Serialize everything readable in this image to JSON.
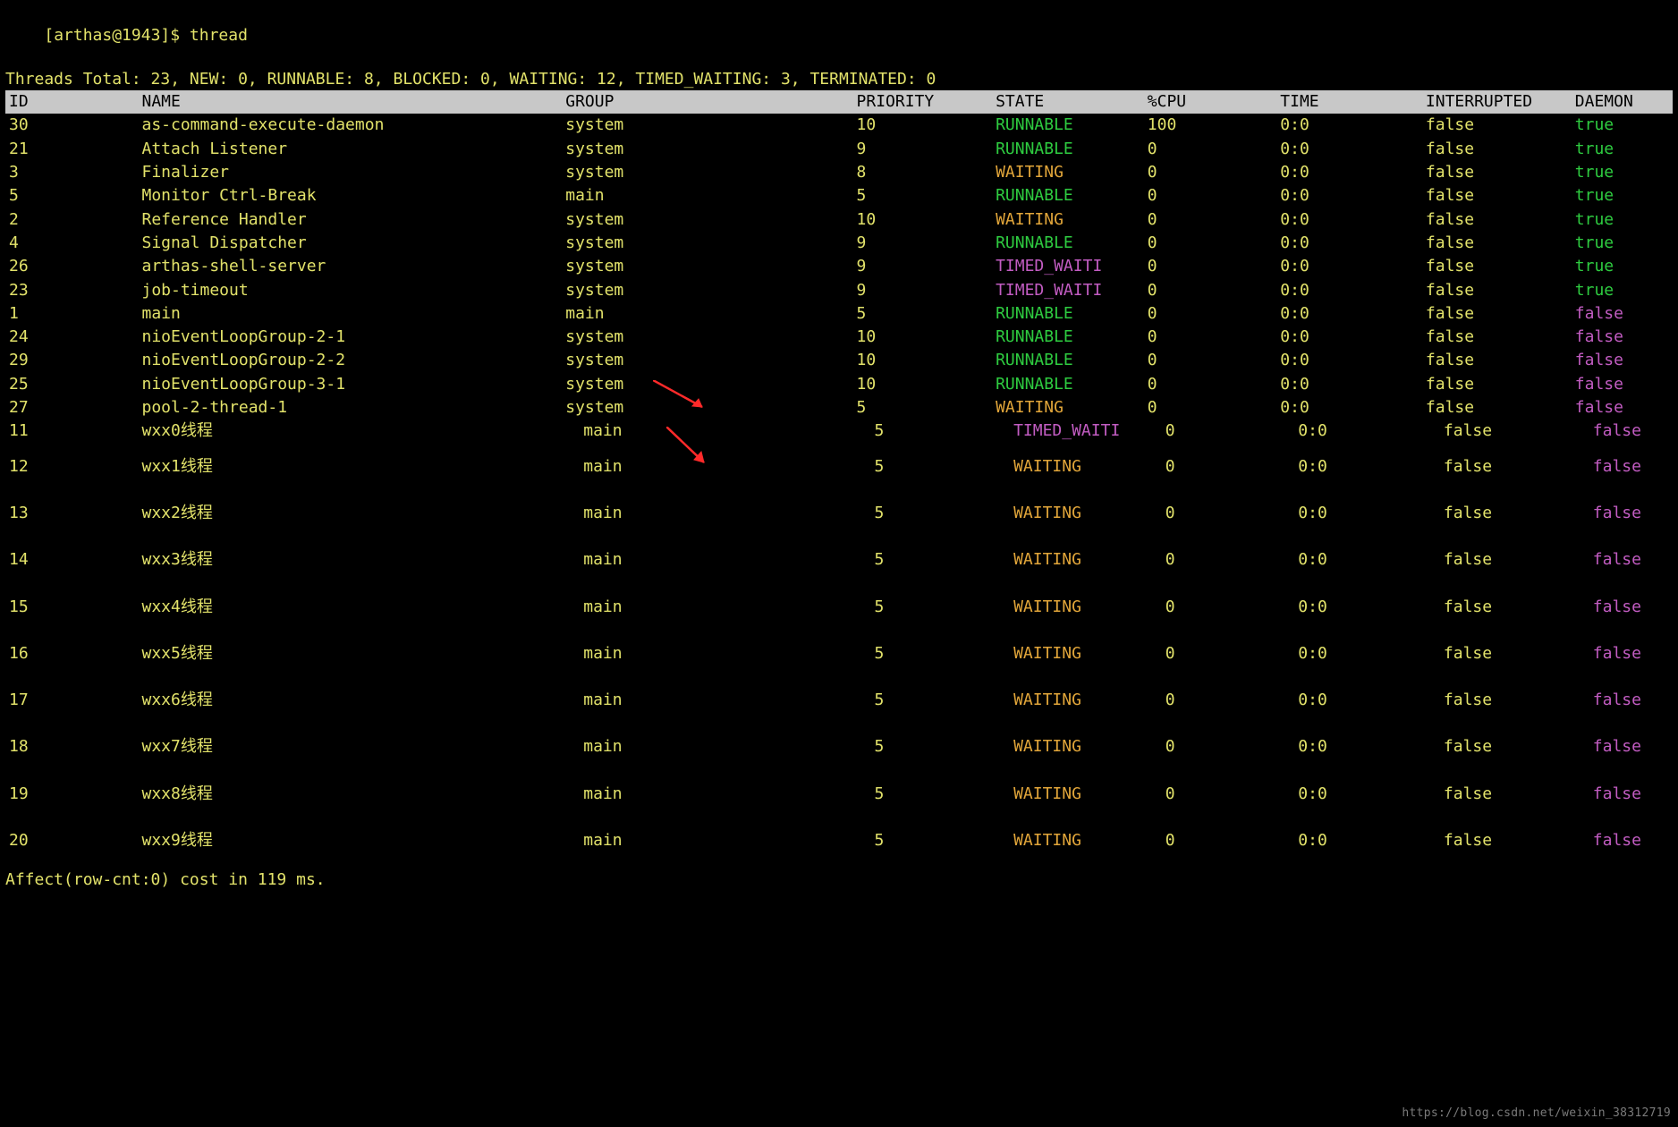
{
  "prompt": "[arthas@1943]$ ",
  "command": "thread",
  "summary": "Threads Total: 23, NEW: 0, RUNNABLE: 8, BLOCKED: 0, WAITING: 12, TIMED_WAITING: 3, TERMINATED: 0",
  "columns": {
    "id": "ID",
    "name": "NAME",
    "group": "GROUP",
    "priority": "PRIORITY",
    "state": "STATE",
    "cpu": "%CPU",
    "time": "TIME",
    "interrupted": "INTERRUPTED",
    "daemon": "DAEMON"
  },
  "rows_compact": [
    {
      "id": "30",
      "name": "as-command-execute-daemon",
      "group": "system",
      "priority": "10",
      "state": "RUNNABLE",
      "cpu": "100",
      "time": "0:0",
      "interrupted": "false",
      "daemon": "true"
    },
    {
      "id": "21",
      "name": "Attach Listener",
      "group": "system",
      "priority": "9",
      "state": "RUNNABLE",
      "cpu": "0",
      "time": "0:0",
      "interrupted": "false",
      "daemon": "true"
    },
    {
      "id": "3",
      "name": "Finalizer",
      "group": "system",
      "priority": "8",
      "state": "WAITING",
      "cpu": "0",
      "time": "0:0",
      "interrupted": "false",
      "daemon": "true"
    },
    {
      "id": "5",
      "name": "Monitor Ctrl-Break",
      "group": "main",
      "priority": "5",
      "state": "RUNNABLE",
      "cpu": "0",
      "time": "0:0",
      "interrupted": "false",
      "daemon": "true"
    },
    {
      "id": "2",
      "name": "Reference Handler",
      "group": "system",
      "priority": "10",
      "state": "WAITING",
      "cpu": "0",
      "time": "0:0",
      "interrupted": "false",
      "daemon": "true"
    },
    {
      "id": "4",
      "name": "Signal Dispatcher",
      "group": "system",
      "priority": "9",
      "state": "RUNNABLE",
      "cpu": "0",
      "time": "0:0",
      "interrupted": "false",
      "daemon": "true"
    },
    {
      "id": "26",
      "name": "arthas-shell-server",
      "group": "system",
      "priority": "9",
      "state": "TIMED_WAITI",
      "cpu": "0",
      "time": "0:0",
      "interrupted": "false",
      "daemon": "true"
    },
    {
      "id": "23",
      "name": "job-timeout",
      "group": "system",
      "priority": "9",
      "state": "TIMED_WAITI",
      "cpu": "0",
      "time": "0:0",
      "interrupted": "false",
      "daemon": "true"
    },
    {
      "id": "1",
      "name": "main",
      "group": "main",
      "priority": "5",
      "state": "RUNNABLE",
      "cpu": "0",
      "time": "0:0",
      "interrupted": "false",
      "daemon": "false"
    },
    {
      "id": "24",
      "name": "nioEventLoopGroup-2-1",
      "group": "system",
      "priority": "10",
      "state": "RUNNABLE",
      "cpu": "0",
      "time": "0:0",
      "interrupted": "false",
      "daemon": "false"
    },
    {
      "id": "29",
      "name": "nioEventLoopGroup-2-2",
      "group": "system",
      "priority": "10",
      "state": "RUNNABLE",
      "cpu": "0",
      "time": "0:0",
      "interrupted": "false",
      "daemon": "false"
    },
    {
      "id": "25",
      "name": "nioEventLoopGroup-3-1",
      "group": "system",
      "priority": "10",
      "state": "RUNNABLE",
      "cpu": "0",
      "time": "0:0",
      "interrupted": "false",
      "daemon": "false"
    },
    {
      "id": "27",
      "name": "pool-2-thread-1",
      "group": "system",
      "priority": "5",
      "state": "WAITING",
      "cpu": "0",
      "time": "0:0",
      "interrupted": "false",
      "daemon": "false"
    },
    {
      "id": "11",
      "name": "wxx0线程",
      "group": "main",
      "priority": "5",
      "state": "TIMED_WAITI",
      "cpu": "0",
      "time": "0:0",
      "interrupted": "false",
      "daemon": "false",
      "indent": true
    }
  ],
  "rows_spaced": [
    {
      "id": "12",
      "name": "wxx1线程",
      "group": "main",
      "priority": "5",
      "state": "WAITING",
      "cpu": "0",
      "time": "0:0",
      "interrupted": "false",
      "daemon": "false"
    },
    {
      "id": "13",
      "name": "wxx2线程",
      "group": "main",
      "priority": "5",
      "state": "WAITING",
      "cpu": "0",
      "time": "0:0",
      "interrupted": "false",
      "daemon": "false"
    },
    {
      "id": "14",
      "name": "wxx3线程",
      "group": "main",
      "priority": "5",
      "state": "WAITING",
      "cpu": "0",
      "time": "0:0",
      "interrupted": "false",
      "daemon": "false"
    },
    {
      "id": "15",
      "name": "wxx4线程",
      "group": "main",
      "priority": "5",
      "state": "WAITING",
      "cpu": "0",
      "time": "0:0",
      "interrupted": "false",
      "daemon": "false"
    },
    {
      "id": "16",
      "name": "wxx5线程",
      "group": "main",
      "priority": "5",
      "state": "WAITING",
      "cpu": "0",
      "time": "0:0",
      "interrupted": "false",
      "daemon": "false"
    },
    {
      "id": "17",
      "name": "wxx6线程",
      "group": "main",
      "priority": "5",
      "state": "WAITING",
      "cpu": "0",
      "time": "0:0",
      "interrupted": "false",
      "daemon": "false"
    },
    {
      "id": "18",
      "name": "wxx7线程",
      "group": "main",
      "priority": "5",
      "state": "WAITING",
      "cpu": "0",
      "time": "0:0",
      "interrupted": "false",
      "daemon": "false"
    },
    {
      "id": "19",
      "name": "wxx8线程",
      "group": "main",
      "priority": "5",
      "state": "WAITING",
      "cpu": "0",
      "time": "0:0",
      "interrupted": "false",
      "daemon": "false"
    },
    {
      "id": "20",
      "name": "wxx9线程",
      "group": "main",
      "priority": "5",
      "state": "WAITING",
      "cpu": "0",
      "time": "0:0",
      "interrupted": "false",
      "daemon": "false"
    }
  ],
  "footer": "Affect(row-cnt:0) cost in 119 ms.",
  "watermark": "https://blog.csdn.net/weixin_38312719"
}
